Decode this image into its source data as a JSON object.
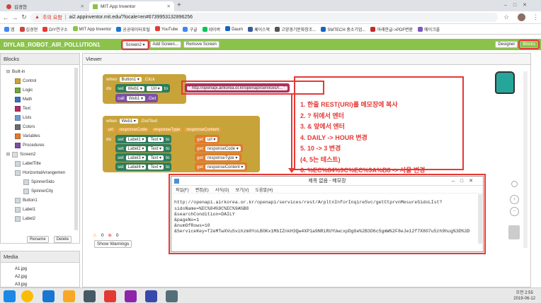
{
  "tabs": [
    {
      "label": "김경현"
    },
    {
      "label": "MIT App Inventor"
    }
  ],
  "browser": {
    "security": "주의 요함",
    "url": "ai2.appinventor.mit.edu/?locale=en#6739953132896256"
  },
  "bookmarks": [
    "앱",
    "김경현",
    "DIY연구소",
    "MIT App Inventor",
    "공공데이터포털",
    "YouTube",
    "구글",
    "네이버",
    "Daum",
    "페이스북",
    "고양경기문화창조...",
    "SMTECH 중소기업...",
    "아래한글->PDF변환",
    "메이크올"
  ],
  "app": {
    "project": "DIYLAB_ROBOT_AIR_POLLUTION1",
    "screen": "Screen2 ▾",
    "add_screen": "Add Screen...",
    "remove_screen": "Remove Screen",
    "designer": "Designer",
    "blocks": "Blocks"
  },
  "left": {
    "blocks_header": "Blocks",
    "builtin": "Built-in",
    "builtin_items": [
      "Control",
      "Logic",
      "Math",
      "Text",
      "Lists",
      "Colors",
      "Variables",
      "Procedures"
    ],
    "builtin_colors": [
      "#c8a33a",
      "#6fa83a",
      "#3f6fbf",
      "#b32d5e",
      "#6e9bd1",
      "#6b6b6b",
      "#e07b2c",
      "#7b4fa3"
    ],
    "screen2": "Screen2",
    "screen_items": [
      "LabelTitle",
      "HorizontalArrangemen",
      "SpinnerSido",
      "SpinnerCity",
      "Button1",
      "Label1",
      "Label2"
    ],
    "rename": "Rename",
    "delete": "Delete",
    "media_header": "Media",
    "media": [
      "A1.jpg",
      "A2.jpg",
      "A3.jpg"
    ]
  },
  "viewer": {
    "header": "Viewer",
    "warn_count": "0",
    "err_count": "0",
    "show_warnings": "Show Warnings"
  },
  "blocks1": {
    "when": "when",
    "comp": "Button1 ▾",
    "event": ".Click",
    "do": "do",
    "set": "set",
    "web": "Web1 ▾",
    "prop": ". Url ▾",
    "to": "to",
    "url_value": "\" http://openapi.airkorea.or.kr/openapi/services/r... \"",
    "call": "call",
    "call_comp": "Web1 ▾",
    "call_method": ".Get"
  },
  "blocks2": {
    "when": "when",
    "comp": "Web1 ▾",
    "event": ".GotText",
    "params": [
      "url",
      "responseCode",
      "responseType",
      "responseContent"
    ],
    "do": "do",
    "rows": [
      {
        "label": "Label1 ▾",
        "prop": "Text ▾",
        "get": "url ▾"
      },
      {
        "label": "Label2 ▾",
        "prop": "Text ▾",
        "get": "responseCode ▾"
      },
      {
        "label": "Label3 ▾",
        "prop": "Text ▾",
        "get": "responseType ▾"
      },
      {
        "label": "Label4 ▾",
        "prop": "Text ▾",
        "get": "responseContent ▾"
      }
    ],
    "set": "set",
    "to": "to",
    "getword": "get"
  },
  "notes": [
    "1. 한줄 REST(URI)를 메모장에 복사",
    "2. ? 뒤에서 엔터",
    "3. & 앞에서 엔터",
    "4. DAILY -> HOUR 변경",
    "5. 10 -> 3 변경",
    "(4, 5는 테스트)",
    "6. %EC%84%9C%EC%9A%B8 -> 서울 변경"
  ],
  "notepad": {
    "title": "제목 없음 - 메모장",
    "menu": [
      "파일(F)",
      "편집(E)",
      "서식(O)",
      "보기(V)",
      "도움말(H)"
    ],
    "lines": [
      "http://openapi.airkorea.or.kr/openapi/services/rest/ArpltnInforInqireSvc/getCtprvnMesureSidoLIst?",
      "sidoName=%EC%84%9C%EC%9A%B8",
      "&searchCondition=DAILY",
      "&pageNo=1",
      "&numOfRows=10",
      "&ServiceKey=T2eMTwXVuSvihzm0YoLBOKx1MbIZnkH3Qw4XP1a9NRiRUYUwcxpDgGe%2B3D6c5gmW%2F8eJe12f7X807u5zh9hug%3D%3D"
    ]
  },
  "taskbar": {
    "time": "오전 2:55",
    "date": "2019-06-12"
  }
}
